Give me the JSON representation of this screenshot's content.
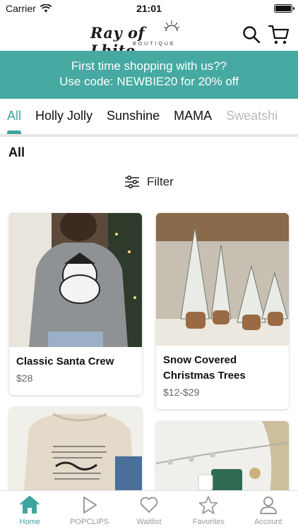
{
  "status_bar": {
    "carrier": "Carrier",
    "time": "21:01"
  },
  "brand": {
    "name": "Ray of Lhite",
    "tagline": "BOUTIQUE"
  },
  "promo": {
    "line1": "First time shopping with us??",
    "line2": "Use code: NEWBIE20 for 20% off"
  },
  "tabs": [
    "All",
    "Holly Jolly",
    "Sunshine",
    "MAMA",
    "Sweatshi"
  ],
  "section_title": "All",
  "filter_label": "Filter",
  "products": [
    {
      "name": "Classic Santa Crew",
      "price": "$28"
    },
    {
      "name": "Snow Covered Christmas Trees",
      "price": "$12-$29"
    },
    {
      "name": "",
      "price": ""
    },
    {
      "name": "",
      "price": ""
    }
  ],
  "nav": [
    {
      "label": "Home",
      "icon": "home-icon"
    },
    {
      "label": "POPCLIPS",
      "icon": "play-icon"
    },
    {
      "label": "Waitlist",
      "icon": "heart-icon"
    },
    {
      "label": "Favorites",
      "icon": "star-icon"
    },
    {
      "label": "Account",
      "icon": "user-icon"
    }
  ],
  "colors": {
    "accent": "#3ea59e",
    "banner": "#46a9a2"
  }
}
